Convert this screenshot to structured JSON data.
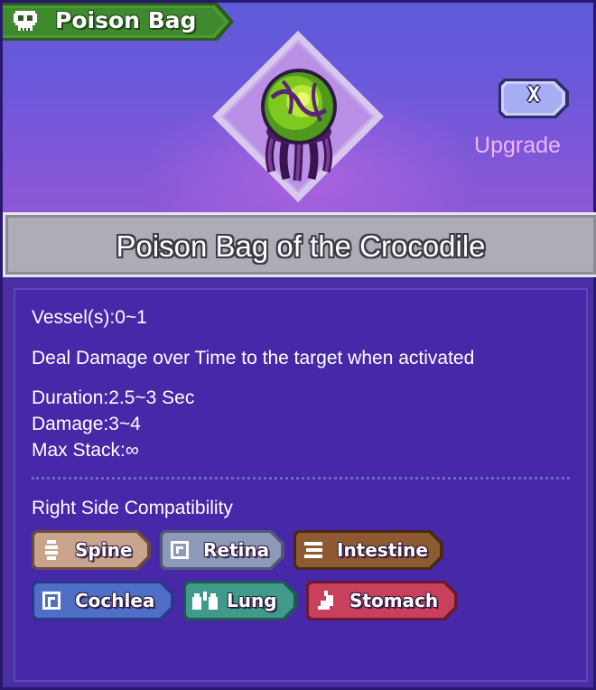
{
  "header": {
    "category_label": "Poison Bag",
    "category_icon": "skull-icon",
    "item_icon": "poison-bag-icon",
    "close_label": "X",
    "upgrade_label": "Upgrade"
  },
  "item": {
    "title": "Poison Bag of the Crocodile"
  },
  "stats": {
    "vessels": "Vessel(s):0~1",
    "description": "Deal Damage over Time to the target when activated",
    "duration": "Duration:2.5~3 Sec",
    "damage": "Damage:3~4",
    "max_stack_label": "Max Stack:",
    "max_stack_value": "∞"
  },
  "compatibility": {
    "label": "Right Side Compatibility",
    "organs": [
      {
        "name": "Spine",
        "icon": "spine-icon",
        "color": "#c9a48c"
      },
      {
        "name": "Retina",
        "icon": "retina-icon",
        "color": "#8d9ab8"
      },
      {
        "name": "Intestine",
        "icon": "intestine-icon",
        "color": "#8e5a32"
      },
      {
        "name": "Cochlea",
        "icon": "cochlea-icon",
        "color": "#4f6fc7"
      },
      {
        "name": "Lung",
        "icon": "lung-icon",
        "color": "#3f9a8c"
      },
      {
        "name": "Stomach",
        "icon": "stomach-icon",
        "color": "#c8405c"
      }
    ]
  },
  "colors": {
    "tag_green": "#3f8a2e",
    "upgrade_pink": "#f0b4ff",
    "panel_purple": "#4628a8"
  }
}
